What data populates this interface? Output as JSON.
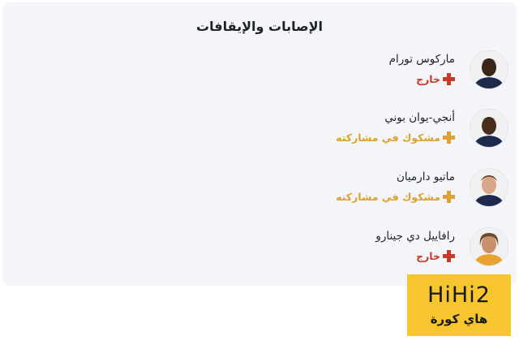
{
  "section": {
    "title": "الإصابات والإيقافات"
  },
  "colors": {
    "out": "#c83a2a",
    "doubtful": "#dca12e"
  },
  "players": [
    {
      "name": "ماركوس تورام",
      "status": "خارج",
      "status_type": "out"
    },
    {
      "name": "أنجي-يوان بوني",
      "status": "مشكوك في مشاركته",
      "status_type": "doubtful"
    },
    {
      "name": "ماتيو دارميان",
      "status": "مشكوك في مشاركته",
      "status_type": "doubtful"
    },
    {
      "name": "رافاييل دي جينارو",
      "status": "خارج",
      "status_type": "out"
    }
  ],
  "logo": {
    "main": "HiHi2",
    "sub": "هاي كورة"
  }
}
